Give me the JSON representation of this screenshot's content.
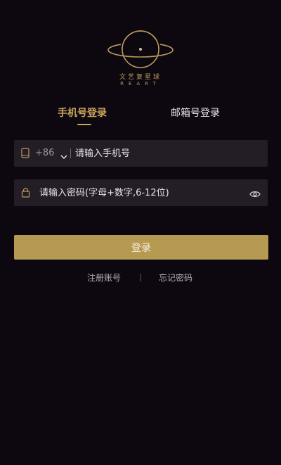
{
  "brand": {
    "name_cn": "文艺复星球",
    "name_en": "REART"
  },
  "tabs": [
    {
      "label": "手机号登录",
      "active": true
    },
    {
      "label": "邮箱号登录",
      "active": false
    }
  ],
  "phone_field": {
    "icon": "phone-icon",
    "country_code": "+86",
    "chevron_icon": "chevron-down-icon",
    "placeholder": "请输入手机号",
    "value": ""
  },
  "password_field": {
    "icon": "lock-icon",
    "placeholder": "请输入密码(字母+数字,6-12位)",
    "value": "",
    "toggle_icon": "eye-icon"
  },
  "login_button": {
    "label": "登录"
  },
  "links": {
    "register": "注册账号",
    "forgot_password": "忘记密码"
  },
  "colors": {
    "background": "#0d0810",
    "accent_gold": "#c8a35a",
    "button_gold": "#b69a52",
    "field_bg": "#231e26"
  }
}
